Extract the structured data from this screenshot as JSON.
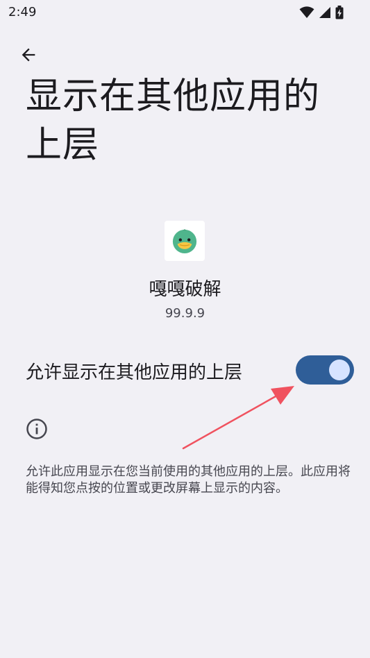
{
  "status_bar": {
    "time": "2:49",
    "icons": [
      "wifi-icon",
      "cellular-signal-icon",
      "battery-charging-icon"
    ]
  },
  "header": {
    "back_icon": "arrow-back-icon",
    "title": "显示在其他应用的上层"
  },
  "app": {
    "icon": "duck-app-icon",
    "name": "嘎嘎破解",
    "version": "99.9.9"
  },
  "setting": {
    "label": "允许显示在其他应用的上层",
    "enabled": true
  },
  "info": {
    "icon": "info-icon",
    "description": "允许此应用显示在您当前使用的其他应用的上层。此应用将能得知您点按的位置或更改屏幕上显示的内容。"
  },
  "colors": {
    "background": "#f1f0f5",
    "switch_track": "#2f5e98",
    "switch_thumb": "#d6e3ff",
    "annotation_arrow": "#f0525f"
  }
}
